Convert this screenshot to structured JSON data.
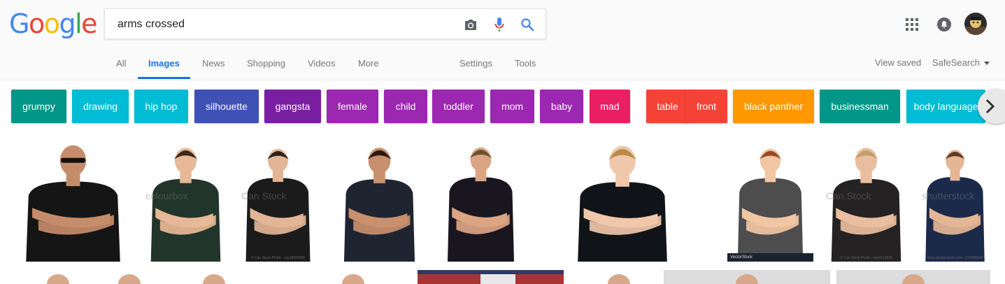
{
  "logo": {
    "letters": [
      "G",
      "o",
      "o",
      "g",
      "l",
      "e"
    ],
    "colors": [
      "#4285F4",
      "#EA4335",
      "#FBBC05",
      "#4285F4",
      "#34A853",
      "#EA4335"
    ]
  },
  "search": {
    "value": "arms crossed"
  },
  "tabs": [
    {
      "label": "All"
    },
    {
      "label": "Images",
      "active": true
    },
    {
      "label": "News"
    },
    {
      "label": "Shopping"
    },
    {
      "label": "Videos"
    },
    {
      "label": "More"
    },
    {
      "label": "Settings"
    },
    {
      "label": "Tools"
    }
  ],
  "right_links": {
    "view_saved": "View saved",
    "safesearch": "SafeSearch"
  },
  "header_icons": [
    "apps-grid-icon",
    "notifications-icon",
    "avatar"
  ],
  "chips": [
    {
      "label": "grumpy",
      "color": "#009688"
    },
    {
      "label": "drawing",
      "color": "#00BCD4"
    },
    {
      "label": "hip hop",
      "color": "#00BCD4"
    },
    {
      "label": "silhouette",
      "color": "#3F51B5"
    },
    {
      "label": "gangsta",
      "color": "#7B1FA2"
    },
    {
      "label": "female",
      "color": "#9C27B0"
    },
    {
      "label": "child",
      "color": "#9C27B0"
    },
    {
      "label": "toddler",
      "color": "#9C27B0"
    },
    {
      "label": "mom",
      "color": "#9C27B0"
    },
    {
      "label": "baby",
      "color": "#9C27B0"
    },
    {
      "label": "mad",
      "color": "#E91E63"
    },
    {
      "label": "table",
      "color": "#F44336"
    },
    {
      "label": "front",
      "color": "#F44336"
    },
    {
      "label": "black panther",
      "color": "#FF9800"
    },
    {
      "label": "businessman",
      "color": "#009688"
    },
    {
      "label": "body language",
      "color": "#00BCD4"
    }
  ],
  "images": [
    {
      "name": "bouncer-black-shirt",
      "shirt": "#151515",
      "skin": "#c58c6b",
      "hair": "none",
      "sunglasses": true,
      "watermark": ""
    },
    {
      "name": "teen-green-shirt",
      "shirt": "#22352a",
      "skin": "#e7b897",
      "hair": "#3b2a1c",
      "watermark": "colourbox",
      "credit": ""
    },
    {
      "name": "teen-black-tshirt",
      "shirt": "#1b1b1b",
      "skin": "#e2b596",
      "hair": "#2a2018",
      "watermark": "Can Stock",
      "credit": "© Can Stock Photo - csp18293508"
    },
    {
      "name": "man-navy-tshirt",
      "shirt": "#1f2431",
      "skin": "#c8906d",
      "hair": "#2a1a12",
      "watermark": "",
      "credit": ""
    },
    {
      "name": "man-dark-tshirt",
      "shirt": "#1a1620",
      "skin": "#dba584",
      "hair": "#6b5230",
      "watermark": "",
      "credit": ""
    },
    {
      "name": "businesswoman-blazer",
      "shirt": "#101418",
      "skin": "#efc7aa",
      "hair": "#b98b48",
      "watermark": "",
      "credit": ""
    },
    {
      "name": "cartoon-man-vector",
      "shirt": "#4d4d4d",
      "skin": "#f1c6a3",
      "hair": "#9a4b2a",
      "watermark": "",
      "credit": "VectorStock"
    },
    {
      "name": "woman-black-top",
      "shirt": "#242222",
      "skin": "#e9bea0",
      "hair": "#c2a06a",
      "watermark": "Can Stock",
      "credit": "© Can Stock Photo - csp1613833"
    },
    {
      "name": "man-navy-shirt",
      "shirt": "#1c2a4a",
      "skin": "#e4b695",
      "hair": "#5b3c23",
      "watermark": "shutterstock",
      "credit": "www.shutterstock.com · 213086344"
    }
  ]
}
